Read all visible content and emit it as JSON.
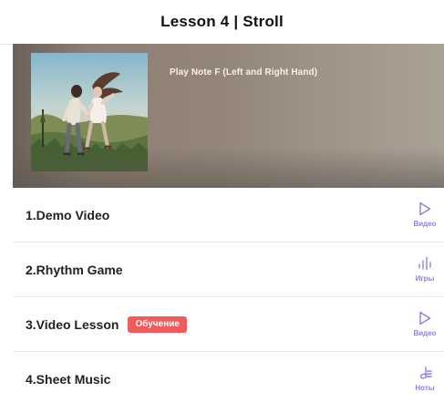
{
  "header": {
    "title": "Lesson 4 | Stroll"
  },
  "hero": {
    "subtitle": "Play Note F (Left and Right Hand)"
  },
  "lessons": [
    {
      "label": "1.Demo Video",
      "action_label": "Видео",
      "icon": "play-icon"
    },
    {
      "label": "2.Rhythm Game",
      "action_label": "Игры",
      "icon": "rhythm-bars-icon"
    },
    {
      "label": "3.Video Lesson",
      "tag": "Обучение",
      "action_label": "Видео",
      "icon": "play-icon"
    },
    {
      "label": "4.Sheet Music",
      "action_label": "Ноты",
      "icon": "sheet-music-icon"
    }
  ],
  "colors": {
    "accent": "#8b83e6",
    "tag": "#f15b5b",
    "hero_bg": "#938679"
  }
}
